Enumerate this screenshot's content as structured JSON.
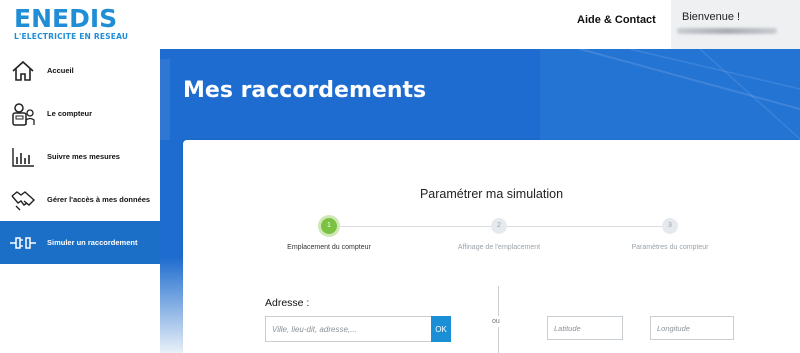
{
  "header": {
    "logo_word": "ENEDIS",
    "logo_tagline": "L'ELECTRICITE EN RESEAU",
    "help_link": "Aide & Contact",
    "welcome": "Bienvenue !"
  },
  "sidebar": {
    "items": [
      {
        "label": "Accueil",
        "icon": "home-icon"
      },
      {
        "label": "Le compteur",
        "icon": "meter-icon"
      },
      {
        "label": "Suivre mes mesures",
        "icon": "bar-chart-icon"
      },
      {
        "label": "Gérer l'accès à mes données",
        "icon": "handshake-icon"
      },
      {
        "label": "Simuler un raccordement",
        "icon": "plug-icon",
        "active": true
      }
    ]
  },
  "hero": {
    "title": "Mes raccordements"
  },
  "simulation": {
    "title": "Paramétrer ma simulation",
    "steps": [
      {
        "number": "1",
        "label": "Emplacement du compteur",
        "active": true
      },
      {
        "number": "2",
        "label": "Affinage de l'emplacement",
        "active": false
      },
      {
        "number": "3",
        "label": "Paramètres du compteur",
        "active": false
      }
    ],
    "address_label": "Adresse :",
    "address_placeholder": "Ville, lieu-dit, adresse,...",
    "ok_label": "OK",
    "or_label": "ou",
    "latitude_placeholder": "Latitude",
    "longitude_placeholder": "Longitude"
  },
  "colors": {
    "brand_blue": "#1f8ed6",
    "hero_blue": "#1e6ccf",
    "active_nav": "#1b6fc7",
    "step_active": "#7bc142"
  }
}
